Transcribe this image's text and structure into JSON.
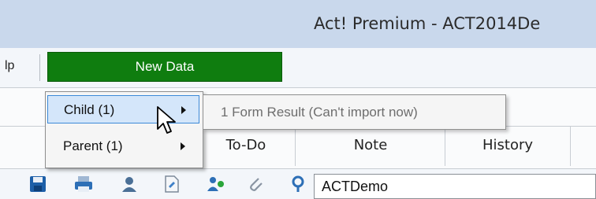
{
  "window": {
    "title": "Act! Premium - ACT2014De"
  },
  "menubar": {
    "help_label": "lp",
    "new_data_label": "New Data",
    "new_data_color": "#0f7d0f"
  },
  "context_menu": {
    "items": [
      {
        "label": "Child (1)",
        "highlighted": true
      },
      {
        "label": "Parent (1)",
        "highlighted": false
      }
    ],
    "highlight_color": "#d4e6fa"
  },
  "submenu": {
    "item": {
      "label": "1 Form Result (Can't import now)",
      "disabled": true
    }
  },
  "tabs": [
    {
      "label": "To-Do"
    },
    {
      "label": "Note"
    },
    {
      "label": "History"
    }
  ],
  "toolbar": {
    "icons": [
      "save-icon",
      "print-icon",
      "contact-icon",
      "document-icon",
      "group-icon",
      "attach-icon",
      "lookup-icon"
    ],
    "database_field": "ACTDemo"
  }
}
